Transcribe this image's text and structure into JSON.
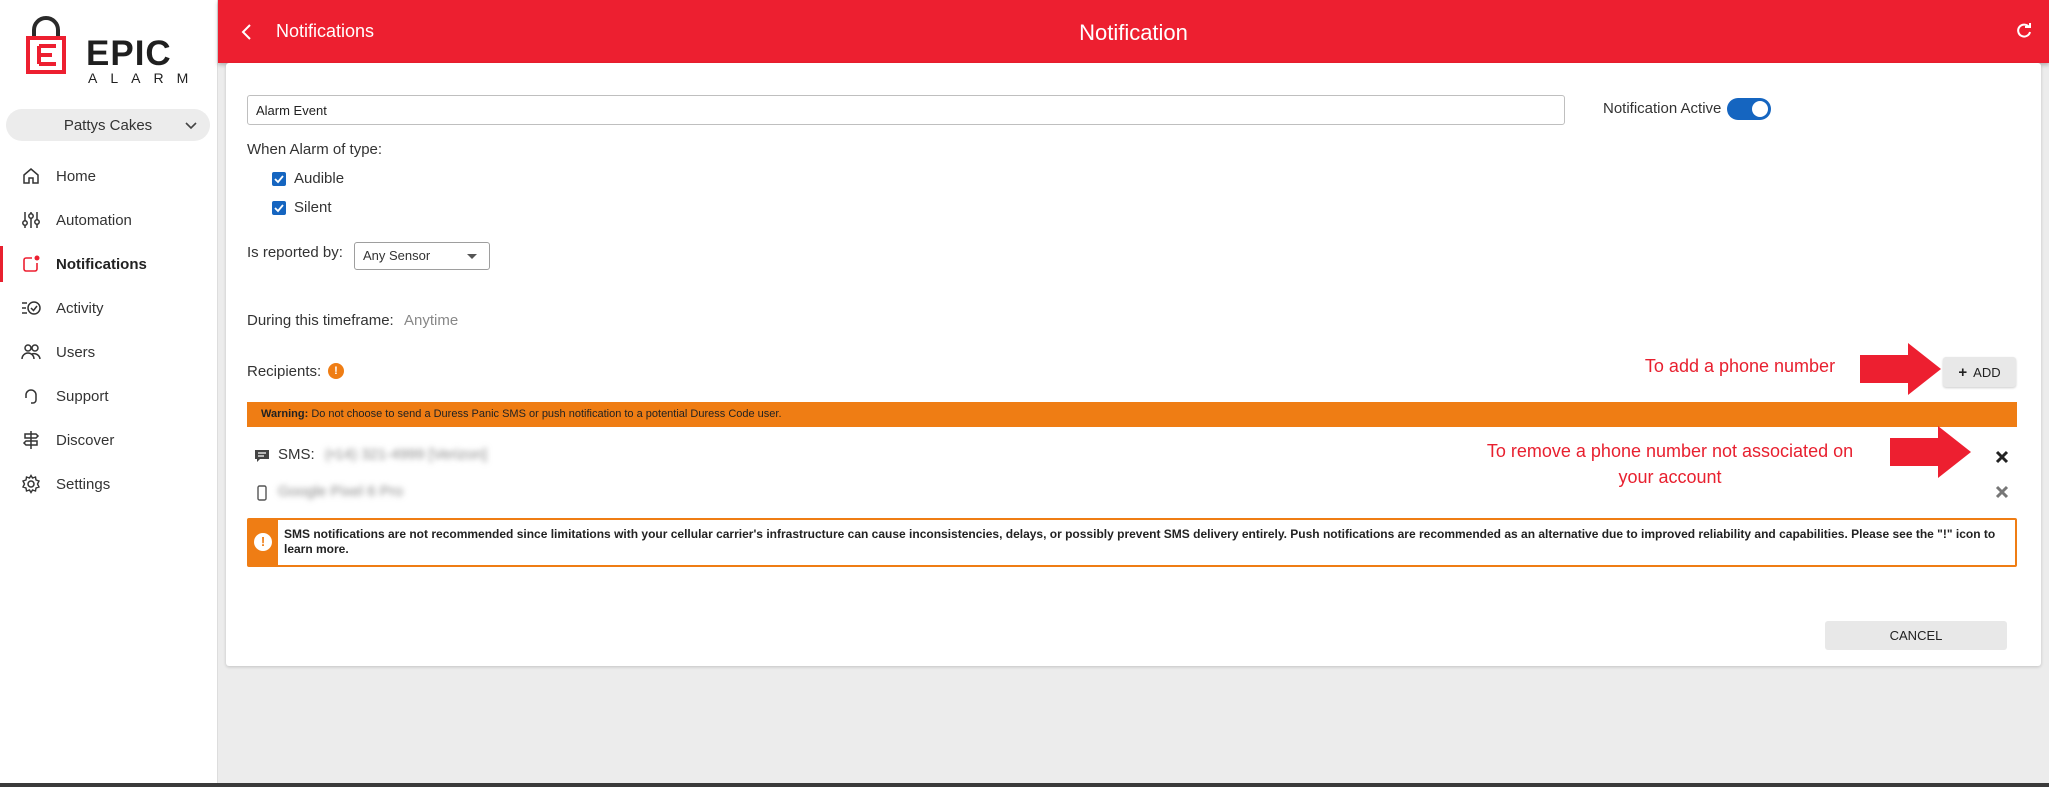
{
  "app": {
    "logo_word": "EPIC",
    "logo_sub": "ALARM",
    "account": "Pattys Cakes"
  },
  "sidebar": {
    "items": [
      {
        "label": "Home",
        "icon": "home-icon"
      },
      {
        "label": "Automation",
        "icon": "sliders-icon"
      },
      {
        "label": "Notifications",
        "icon": "notification-icon",
        "active": true
      },
      {
        "label": "Activity",
        "icon": "activity-icon"
      },
      {
        "label": "Users",
        "icon": "users-icon"
      },
      {
        "label": "Support",
        "icon": "support-icon"
      },
      {
        "label": "Discover",
        "icon": "discover-icon"
      },
      {
        "label": "Settings",
        "icon": "gear-icon"
      }
    ]
  },
  "header": {
    "breadcrumb": "Notifications",
    "title": "Notification"
  },
  "form": {
    "name_value": "Alarm Event",
    "active_label": "Notification Active",
    "active": true,
    "alarm_type_label": "When Alarm of type:",
    "alarm_types": [
      {
        "label": "Audible",
        "checked": true
      },
      {
        "label": "Silent",
        "checked": true
      }
    ],
    "reported_by_label": "Is reported by:",
    "reported_by_value": "Any Sensor",
    "timeframe_label": "During this timeframe:",
    "timeframe_value": "Anytime",
    "recipients_label": "Recipients:",
    "add_label": "ADD",
    "warning_bold": "Warning:",
    "warning_text": "Do not choose to send a Duress Panic SMS or push notification to a potential Duress Code user.",
    "recipients": [
      {
        "prefix": "SMS:",
        "value": "(•14) 321-4999 [Verizon]",
        "icon": "sms-icon"
      },
      {
        "prefix": "",
        "value": "Google Pixel 6 Pro",
        "icon": "phone-icon"
      }
    ],
    "sms_notice": "SMS notifications are not recommended since limitations with your cellular carrier's infrastructure can cause inconsistencies, delays, or possibly prevent SMS delivery entirely. Push notifications are recommended as an alternative due to improved reliability and capabilities. Please see the \"!\" icon to learn more.",
    "cancel_label": "CANCEL"
  },
  "annotations": {
    "add_note": "To add a phone number",
    "remove_note_1": "To remove a phone number not associated on",
    "remove_note_2": "your account"
  },
  "colors": {
    "brand_red": "#ed1f30",
    "accent_blue": "#1565c0",
    "warning_orange": "#ef7d14"
  }
}
